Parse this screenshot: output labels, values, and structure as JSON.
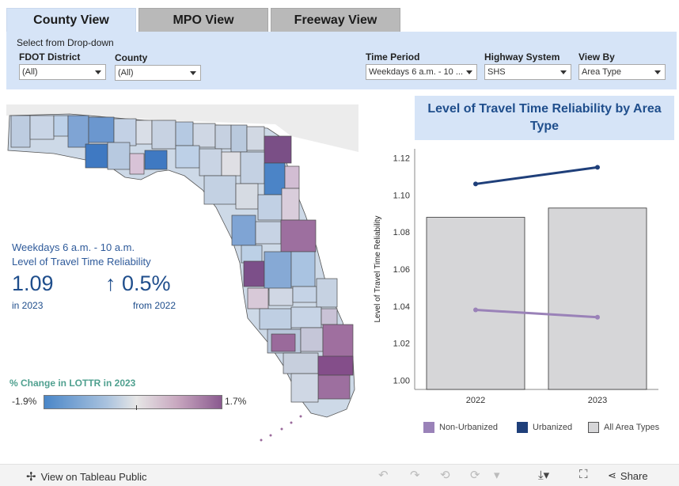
{
  "tabs": [
    "County View",
    "MPO View",
    "Freeway View"
  ],
  "filters": {
    "hint": "Select from Drop-down",
    "fdot_district": {
      "label": "FDOT District",
      "value": "(All)"
    },
    "county": {
      "label": "County",
      "value": "(All)"
    },
    "time_period": {
      "label": "Time Period",
      "value": "Weekdays 6 a.m. - 10 ..."
    },
    "highway_system": {
      "label": "Highway System",
      "value": "SHS"
    },
    "view_by": {
      "label": "View By",
      "value": "Area Type"
    }
  },
  "map_summary": {
    "period": "Weekdays 6 a.m. - 10 a.m.",
    "metric": "Level of Travel Time Reliability",
    "value": "1.09",
    "value_note": "in 2023",
    "change": "0.5%",
    "change_note": "from 2022",
    "change_arrow": "up-arrow"
  },
  "map_legend": {
    "title": "% Change in LOTTR in 2023",
    "min": "-1.9%",
    "max": "1.7%"
  },
  "chart_title": "Level of Travel Time Reliability by Area Type",
  "chart_data": {
    "type": "bar",
    "title": "Level of Travel Time Reliability by Area Type",
    "ylabel": "Level of Travel Time Reliability",
    "xlabel": "",
    "categories": [
      "2022",
      "2023"
    ],
    "ylim": [
      0.995,
      1.125
    ],
    "yticks": [
      "1.00",
      "1.02",
      "1.04",
      "1.06",
      "1.08",
      "1.10",
      "1.12"
    ],
    "bars": {
      "name": "All Area Types",
      "values": [
        1.088,
        1.093
      ],
      "color": "#d6d6d8"
    },
    "lines": [
      {
        "name": "Urbanized",
        "values": [
          1.106,
          1.115
        ],
        "color": "#1f3f7a"
      },
      {
        "name": "Non-Urbanized",
        "values": [
          1.038,
          1.034
        ],
        "color": "#9a82b8"
      }
    ],
    "legend": [
      "Non-Urbanized",
      "Urbanized",
      "All Area Types"
    ],
    "legend_position": "bottom",
    "grid": false
  },
  "footer": {
    "tableau_link": "View on Tableau Public",
    "share": "Share"
  }
}
